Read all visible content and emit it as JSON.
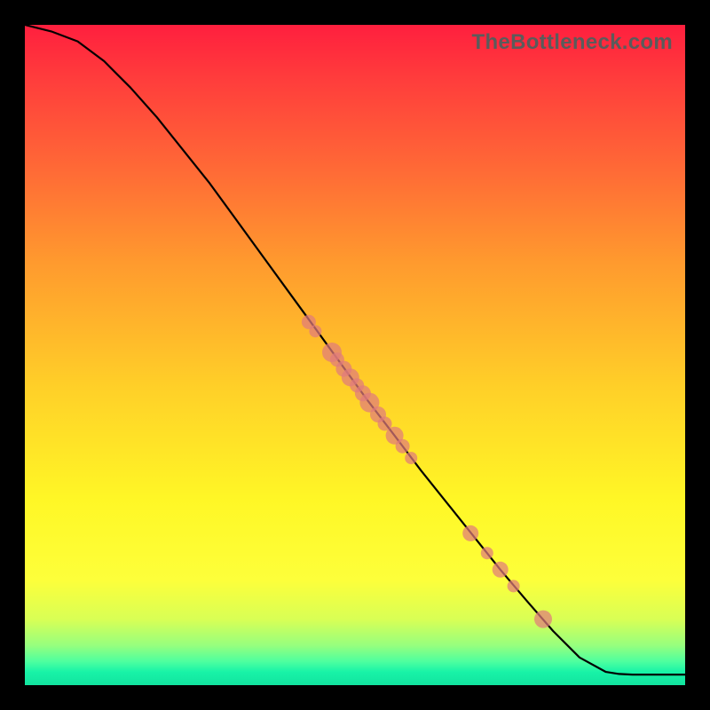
{
  "watermark": "TheBottleneck.com",
  "chart_data": {
    "type": "line",
    "title": "",
    "xlabel": "",
    "ylabel": "",
    "xlim": [
      0,
      100
    ],
    "ylim": [
      0,
      100
    ],
    "curve": {
      "x": [
        0,
        4,
        8,
        12,
        16,
        20,
        24,
        28,
        32,
        36,
        40,
        44,
        48,
        52,
        56,
        60,
        64,
        68,
        72,
        76,
        80,
        84,
        88,
        90,
        92,
        96,
        100
      ],
      "y": [
        100,
        99,
        97.5,
        94.5,
        90.5,
        86,
        81,
        76,
        70.5,
        65,
        59.5,
        54,
        48.5,
        43,
        37.8,
        32.5,
        27.5,
        22.5,
        17.5,
        12.8,
        8.2,
        4.2,
        2.0,
        1.7,
        1.6,
        1.6,
        1.6
      ]
    },
    "points": [
      {
        "x": 43,
        "y": 55.0,
        "r": 8
      },
      {
        "x": 44,
        "y": 53.6,
        "r": 7
      },
      {
        "x": 46.5,
        "y": 50.4,
        "r": 11
      },
      {
        "x": 47.3,
        "y": 49.3,
        "r": 8
      },
      {
        "x": 48.3,
        "y": 47.9,
        "r": 9
      },
      {
        "x": 49.3,
        "y": 46.6,
        "r": 10
      },
      {
        "x": 50.3,
        "y": 45.4,
        "r": 8
      },
      {
        "x": 51.2,
        "y": 44.2,
        "r": 9
      },
      {
        "x": 52.2,
        "y": 42.8,
        "r": 11
      },
      {
        "x": 53.5,
        "y": 41.0,
        "r": 9
      },
      {
        "x": 54.5,
        "y": 39.6,
        "r": 8
      },
      {
        "x": 56.0,
        "y": 37.8,
        "r": 10
      },
      {
        "x": 57.2,
        "y": 36.2,
        "r": 8
      },
      {
        "x": 58.5,
        "y": 34.4,
        "r": 7
      },
      {
        "x": 67.5,
        "y": 23.0,
        "r": 9
      },
      {
        "x": 70.0,
        "y": 20.0,
        "r": 7
      },
      {
        "x": 72.0,
        "y": 17.5,
        "r": 9
      },
      {
        "x": 74.0,
        "y": 15.0,
        "r": 7
      },
      {
        "x": 78.5,
        "y": 10.0,
        "r": 10
      }
    ]
  }
}
